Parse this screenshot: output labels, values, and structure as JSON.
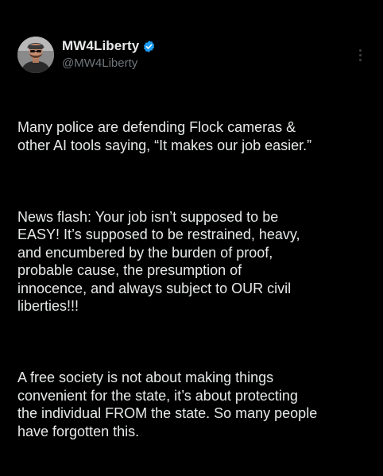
{
  "tweet": {
    "author": {
      "display_name": "MW4Liberty",
      "handle": "@MW4Liberty",
      "verified_icon": "verified-badge-icon",
      "avatar_icon": "profile-avatar"
    },
    "more_icon": "more-vertical-icon",
    "paragraphs": [
      "Many police are defending Flock cameras &\nother AI tools saying, “It makes our job easier.”",
      "News flash:  Your job isn’t supposed to be\nEASY! It’s supposed to be restrained, heavy,\nand encumbered by the burden of proof,\nprobable cause, the presumption of\ninnocence, and always subject to OUR civil\nliberties!!!",
      "A free society is not about making things\nconvenient for the state, it’s about protecting\nthe individual FROM the state. So many people\nhave forgotten this."
    ]
  },
  "colors": {
    "background": "#000000",
    "text_primary": "#e7e9ea",
    "text_secondary": "#71767b",
    "verified": "#1d9bf0"
  }
}
